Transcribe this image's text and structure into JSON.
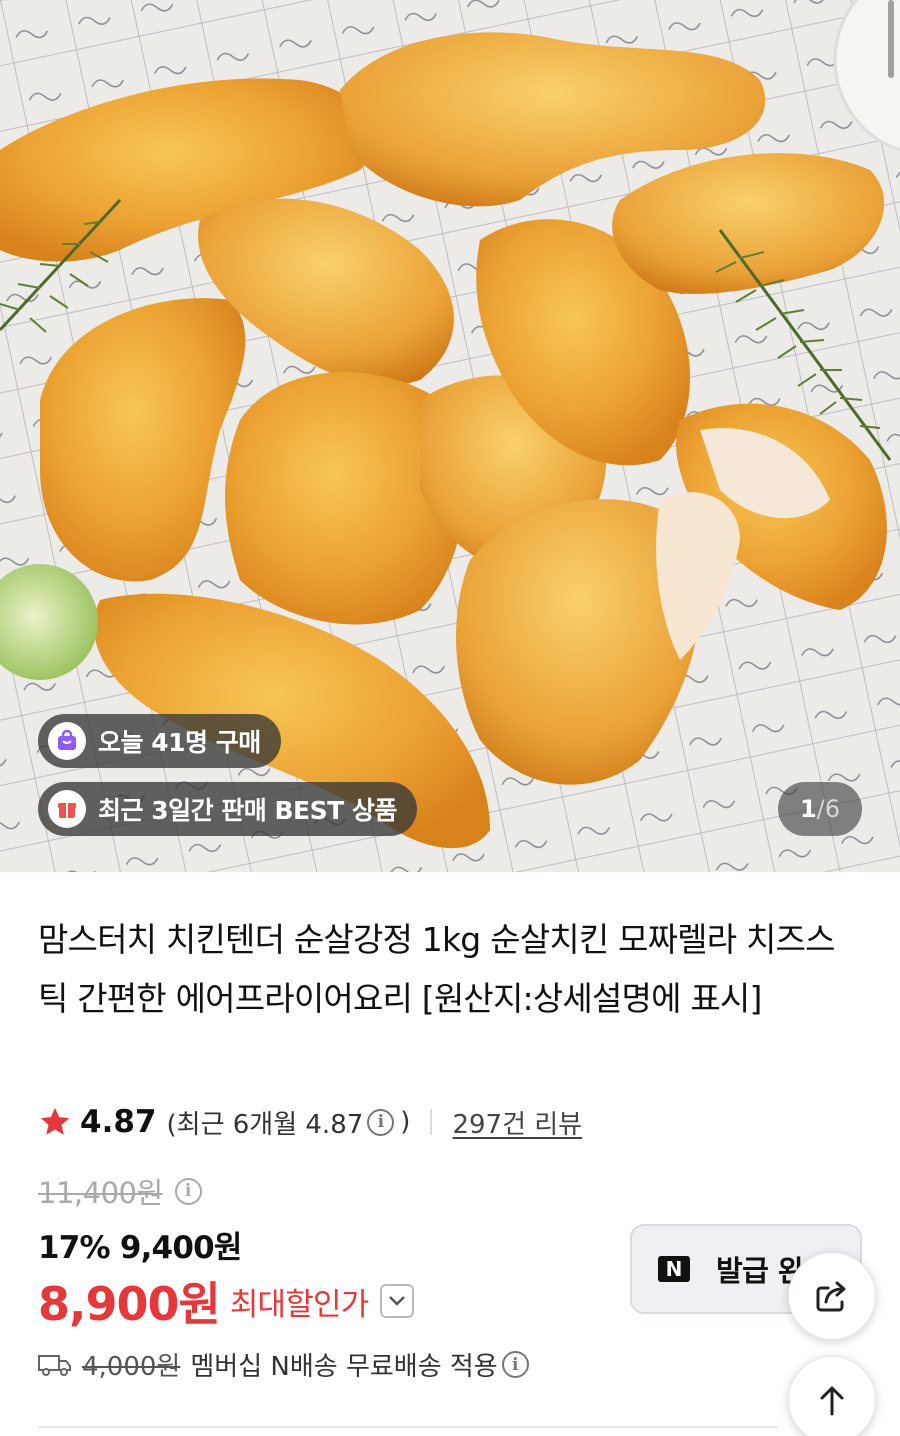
{
  "gallery": {
    "today_badge": "오늘 41명 구매",
    "best_badge": "최근 3일간 판매 BEST 상품",
    "page_current": "1",
    "page_sep": "/",
    "page_total": "6"
  },
  "product": {
    "title": "맘스터치 치킨텐더 순살강정 1kg 순살치킨 모짜렐라 치즈스틱 간편한 에어프라이어요리 [원산지:상세설명에 표시]"
  },
  "rating": {
    "score": "4.87",
    "recent_prefix": "(최근 6개월 4.87",
    "recent_suffix": ")",
    "review_count": "297건 리뷰"
  },
  "price": {
    "original": "11,400원",
    "discount_percent": "17%",
    "sale_price": "9,400원",
    "max_discount_price": "8,900원",
    "max_discount_label": "최대할인가"
  },
  "coupon": {
    "logo": "N",
    "label": "발급 완"
  },
  "shipping": {
    "fee": "4,000원",
    "text": "멤버십 N배송 무료배송 적용"
  },
  "colors": {
    "accent_red": "#e5383b",
    "star": "#e5383b",
    "badge_purple": "#8b5cf6",
    "badge_red": "#ef5350"
  },
  "icons": [
    "bag-icon",
    "gift-icon",
    "star-icon",
    "info-icon",
    "chevron-down-icon",
    "naver-n-icon",
    "share-icon",
    "arrow-up-icon",
    "truck-icon"
  ]
}
